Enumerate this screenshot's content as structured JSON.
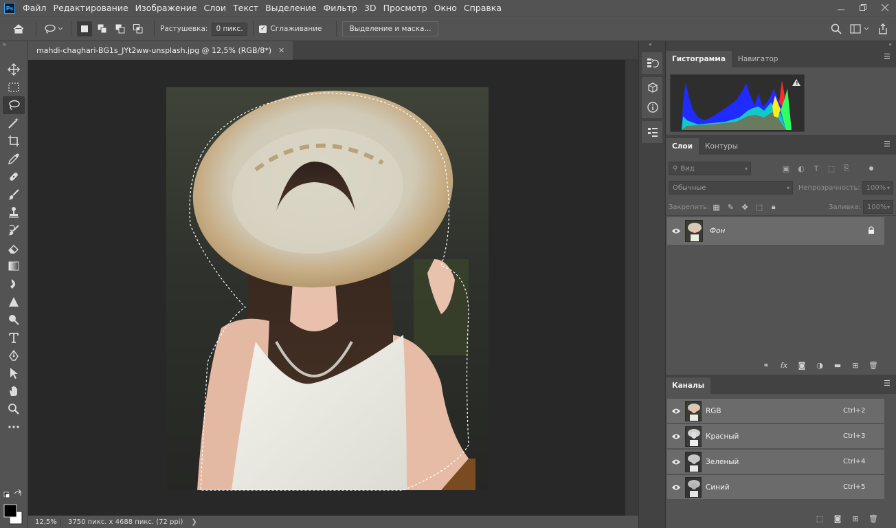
{
  "app": {
    "logo": "Ps"
  },
  "menu": [
    "Файл",
    "Редактирование",
    "Изображение",
    "Слои",
    "Текст",
    "Выделение",
    "Фильтр",
    "3D",
    "Просмотр",
    "Окно",
    "Справка"
  ],
  "options": {
    "feather_label": "Растушевка:",
    "feather_value": "0 пикс.",
    "antialias_label": "Сглаживание",
    "antialias_checked": true,
    "select_mask_label": "Выделение и маска..."
  },
  "document": {
    "tab_title": "mahdi-chaghari-BG1s_JYt2ww-unsplash.jpg @ 12,5% (RGB/8*)",
    "zoom": "12,5%",
    "info": "3750 пикс. x 4688 пикс. (72 ppi)"
  },
  "panels": {
    "top_tabs": [
      "Гистограмма",
      "Навигатор"
    ],
    "layers_tabs": [
      "Слои",
      "Контуры"
    ],
    "layers_filter_placeholder": "Вид",
    "blend_mode": "Обычные",
    "opacity_label": "Непрозрачность:",
    "opacity_value": "100%",
    "lock_label": "Закрепить:",
    "fill_label": "Заливка:",
    "fill_value": "100%",
    "layers": [
      {
        "name": "Фон"
      }
    ],
    "channels_tab": "Каналы",
    "channels": [
      {
        "name": "RGB",
        "shortcut": "Ctrl+2"
      },
      {
        "name": "Красный",
        "shortcut": "Ctrl+3"
      },
      {
        "name": "Зеленый",
        "shortcut": "Ctrl+4"
      },
      {
        "name": "Синий",
        "shortcut": "Ctrl+5"
      }
    ]
  },
  "colors": {
    "ui_dark": "#282828",
    "ui_panel": "#535353",
    "accent": "#31a8ff"
  }
}
